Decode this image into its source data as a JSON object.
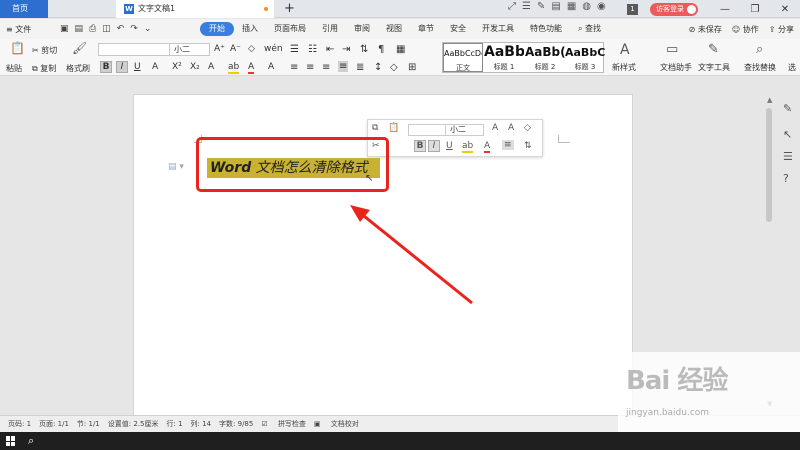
{
  "tabbar": {
    "home": "首页",
    "doc_title": "文字文稿1",
    "add": "+",
    "badge": "1",
    "visitor": "访客登录",
    "min": "—",
    "restore": "❐",
    "close": "✕"
  },
  "menu": {
    "file": "≡ 文件",
    "items": [
      "开始",
      "插入",
      "页面布局",
      "引用",
      "审阅",
      "视图",
      "章节",
      "安全",
      "开发工具",
      "特色功能"
    ],
    "search": "查找",
    "unsaved": "未保存",
    "collab": "协作",
    "share": "分享"
  },
  "ribbon": {
    "cut": "剪切",
    "paste": "粘贴",
    "copy": "复制",
    "format_painter": "格式刷",
    "font_size": "小二",
    "styles": [
      {
        "preview": "AaBbCcDd",
        "name": "正文"
      },
      {
        "preview": "AaBb",
        "name": "标题 1"
      },
      {
        "preview": "AaBb(",
        "name": "标题 2"
      },
      {
        "preview": "AaBbC",
        "name": "标题 3"
      }
    ],
    "new_style": "新样式",
    "doc_helper": "文档助手",
    "text_tools": "文字工具",
    "find_replace": "查找替换",
    "select": "选"
  },
  "mini_toolbar": {
    "font_size": "小二"
  },
  "document": {
    "heading_bold": "Word",
    "heading_rest": " 文档怎么清除格式"
  },
  "status": {
    "page_num": "页码: 1",
    "pages": "页面: 1/1",
    "section": "节: 1/1",
    "setting": "设置值: 2.5厘米",
    "row": "行: 1",
    "col": "列: 14",
    "word_count": "字数: 9/85",
    "spell_check": "拼写检查",
    "doc_proof": "文档校对"
  },
  "watermark": {
    "logo": "Bai 经验",
    "url": "jingyan.baidu.com"
  }
}
